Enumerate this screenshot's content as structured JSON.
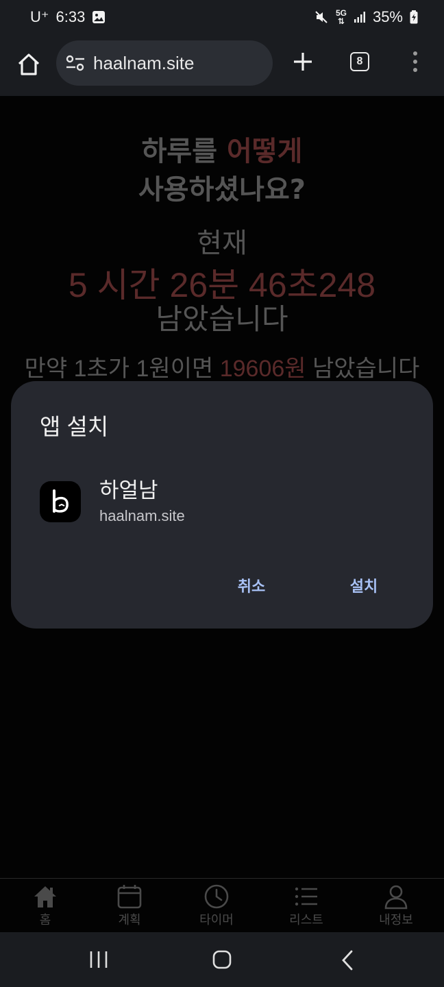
{
  "status_bar": {
    "carrier": "U⁺",
    "time": "6:33",
    "battery": "35%",
    "network": "5G"
  },
  "browser": {
    "url": "haalnam.site",
    "tab_count": "8"
  },
  "page": {
    "heading_line1_a": "하루를",
    "heading_line1_b": "어떻게",
    "heading_line2": "사용하셨나요?",
    "now_label": "현재",
    "hours_value": "5",
    "hours_unit": "시간",
    "minutes_value": "26",
    "minutes_unit": "분",
    "seconds_value": "46",
    "seconds_unit": "초",
    "ms_value": "248",
    "remaining_label": "남았습니다",
    "money_prefix": "만약 1초가 1원이면",
    "money_value": "19606원",
    "money_suffix": "남았습니다",
    "accent_color": "#5a2a2a"
  },
  "dialog": {
    "title": "앱 설치",
    "app_name": "하얼남",
    "app_url": "haalnam.site",
    "cancel_label": "취소",
    "install_label": "설치",
    "button_color": "#a8c1f5"
  },
  "app_nav": {
    "items": [
      {
        "label": "홈",
        "icon": "home-icon"
      },
      {
        "label": "계획",
        "icon": "calendar-icon"
      },
      {
        "label": "타이머",
        "icon": "clock-icon"
      },
      {
        "label": "리스트",
        "icon": "list-icon"
      },
      {
        "label": "내정보",
        "icon": "person-icon"
      }
    ]
  }
}
